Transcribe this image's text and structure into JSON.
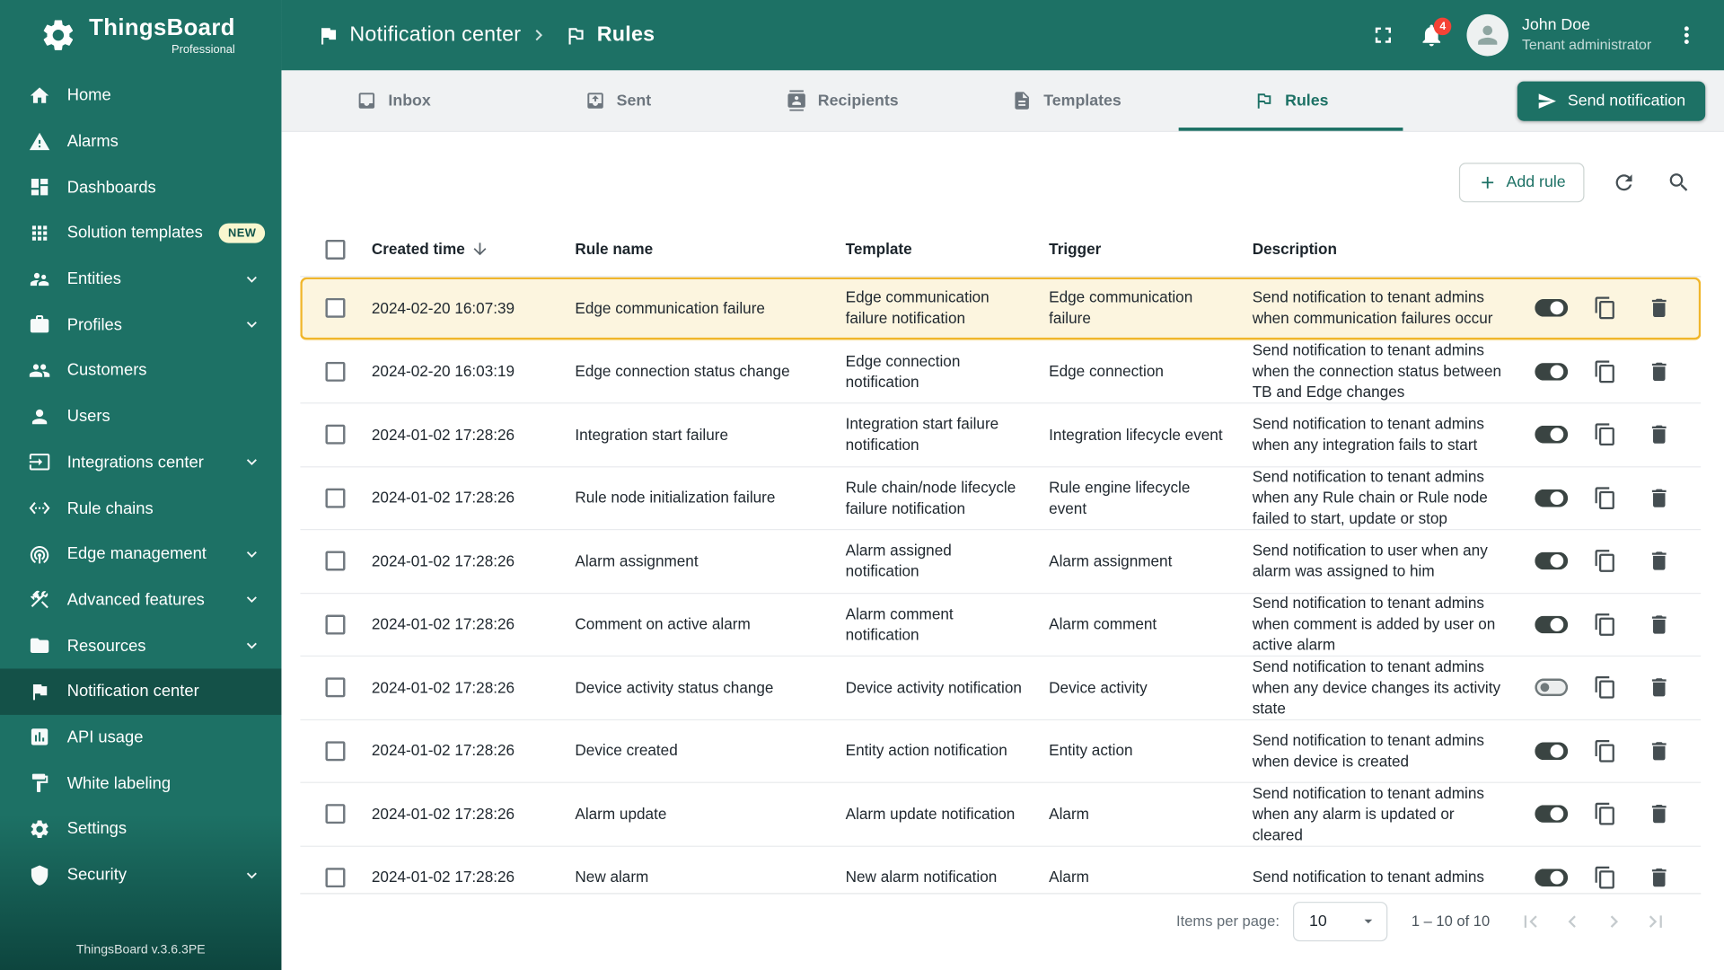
{
  "app": {
    "brand": "ThingsBoard",
    "brand_sub": "Professional",
    "version": "ThingsBoard v.3.6.3PE",
    "logo_icon": "thingsboard-logo-icon"
  },
  "header": {
    "breadcrumb": [
      {
        "icon": "notification-center-icon",
        "label": "Notification center"
      },
      {
        "icon": "rules-icon",
        "label": "Rules"
      }
    ],
    "separator_icon": "chevron-right-icon",
    "fullscreen_icon": "fullscreen-icon",
    "bell_icon": "bell-icon",
    "notifications_count": "4",
    "avatar_icon": "person-icon",
    "menu_icon": "kebab-icon",
    "user": {
      "name": "John Doe",
      "role": "Tenant administrator"
    }
  },
  "sidebar": {
    "expand_icon": "chevron-down-icon",
    "items": [
      {
        "name": "sidebar-item-home",
        "label": "Home",
        "icon": "home-icon"
      },
      {
        "name": "sidebar-item-alarms",
        "label": "Alarms",
        "icon": "alarms-icon"
      },
      {
        "name": "sidebar-item-dashboards",
        "label": "Dashboards",
        "icon": "dashboards-icon"
      },
      {
        "name": "sidebar-item-solution-templates",
        "label": "Solution templates",
        "icon": "solution-templates-icon",
        "badge": "NEW"
      },
      {
        "name": "sidebar-item-entities",
        "label": "Entities",
        "icon": "entities-icon",
        "expandable": true
      },
      {
        "name": "sidebar-item-profiles",
        "label": "Profiles",
        "icon": "profiles-icon",
        "expandable": true
      },
      {
        "name": "sidebar-item-customers",
        "label": "Customers",
        "icon": "customers-icon"
      },
      {
        "name": "sidebar-item-users",
        "label": "Users",
        "icon": "users-icon"
      },
      {
        "name": "sidebar-item-integrations-center",
        "label": "Integrations center",
        "icon": "integrations-icon",
        "expandable": true
      },
      {
        "name": "sidebar-item-rule-chains",
        "label": "Rule chains",
        "icon": "rule-chains-icon"
      },
      {
        "name": "sidebar-item-edge-management",
        "label": "Edge management",
        "icon": "edge-icon",
        "expandable": true
      },
      {
        "name": "sidebar-item-advanced-features",
        "label": "Advanced features",
        "icon": "advanced-features-icon",
        "expandable": true
      },
      {
        "name": "sidebar-item-resources",
        "label": "Resources",
        "icon": "resources-icon",
        "expandable": true
      },
      {
        "name": "sidebar-item-notification-center",
        "label": "Notification center",
        "icon": "notification-center-icon",
        "active": true
      },
      {
        "name": "sidebar-item-api-usage",
        "label": "API usage",
        "icon": "api-usage-icon"
      },
      {
        "name": "sidebar-item-white-labeling",
        "label": "White labeling",
        "icon": "white-labeling-icon"
      },
      {
        "name": "sidebar-item-settings",
        "label": "Settings",
        "icon": "settings-icon"
      },
      {
        "name": "sidebar-item-security",
        "label": "Security",
        "icon": "security-icon",
        "expandable": true
      }
    ]
  },
  "tabs": [
    {
      "name": "tab-inbox",
      "label": "Inbox",
      "icon": "inbox-icon"
    },
    {
      "name": "tab-sent",
      "label": "Sent",
      "icon": "sent-icon"
    },
    {
      "name": "tab-recipients",
      "label": "Recipients",
      "icon": "recipients-icon"
    },
    {
      "name": "tab-templates",
      "label": "Templates",
      "icon": "templates-icon"
    },
    {
      "name": "tab-rules",
      "label": "Rules",
      "icon": "rules-icon",
      "active": true
    }
  ],
  "actions": {
    "send_notification": "Send notification",
    "send_icon": "send-icon",
    "add_rule": "Add rule",
    "add_icon": "plus-icon",
    "refresh_icon": "refresh-icon",
    "search_icon": "search-icon"
  },
  "table": {
    "columns": [
      "Created time",
      "Rule name",
      "Template",
      "Trigger",
      "Description"
    ],
    "sort_icon": "arrow-down-icon",
    "copy_icon": "copy-icon",
    "delete_icon": "delete-icon",
    "rows": [
      {
        "time": "2024-02-20 16:07:39",
        "rule": "Edge communication failure",
        "template": "Edge communication failure notification",
        "trigger": "Edge communication failure",
        "description": "Send notification to tenant admins when communication failures occur",
        "enabled": true,
        "highlighted": true
      },
      {
        "time": "2024-02-20 16:03:19",
        "rule": "Edge connection status change",
        "template": "Edge connection notification",
        "trigger": "Edge connection",
        "description": "Send notification to tenant admins when the connection status between TB and Edge changes",
        "enabled": true
      },
      {
        "time": "2024-01-02 17:28:26",
        "rule": "Integration start failure",
        "template": "Integration start failure notification",
        "trigger": "Integration lifecycle event",
        "description": "Send notification to tenant admins when any integration fails to start",
        "enabled": true
      },
      {
        "time": "2024-01-02 17:28:26",
        "rule": "Rule node initialization failure",
        "template": "Rule chain/node lifecycle failure notification",
        "trigger": "Rule engine lifecycle event",
        "description": "Send notification to tenant admins when any Rule chain or Rule node failed to start, update or stop",
        "enabled": true
      },
      {
        "time": "2024-01-02 17:28:26",
        "rule": "Alarm assignment",
        "template": "Alarm assigned notification",
        "trigger": "Alarm assignment",
        "description": "Send notification to user when any alarm was assigned to him",
        "enabled": true
      },
      {
        "time": "2024-01-02 17:28:26",
        "rule": "Comment on active alarm",
        "template": "Alarm comment notification",
        "trigger": "Alarm comment",
        "description": "Send notification to tenant admins when comment is added by user on active alarm",
        "enabled": true
      },
      {
        "time": "2024-01-02 17:28:26",
        "rule": "Device activity status change",
        "template": "Device activity notification",
        "trigger": "Device activity",
        "description": "Send notification to tenant admins when any device changes its activity state",
        "enabled": false
      },
      {
        "time": "2024-01-02 17:28:26",
        "rule": "Device created",
        "template": "Entity action notification",
        "trigger": "Entity action",
        "description": "Send notification to tenant admins when device is created",
        "enabled": true
      },
      {
        "time": "2024-01-02 17:28:26",
        "rule": "Alarm update",
        "template": "Alarm update notification",
        "trigger": "Alarm",
        "description": "Send notification to tenant admins when any alarm is updated or cleared",
        "enabled": true
      },
      {
        "time": "2024-01-02 17:28:26",
        "rule": "New alarm",
        "template": "New alarm notification",
        "trigger": "Alarm",
        "description": "Send notification to tenant admins",
        "enabled": true
      }
    ]
  },
  "pagination": {
    "items_per_page_label": "Items per page:",
    "items_per_page": "10",
    "range": "1 – 10 of 10",
    "dropdown_icon": "dropdown-icon",
    "first_icon": "first-page-icon",
    "prev_icon": "prev-page-icon",
    "next_icon": "next-page-icon",
    "last_icon": "last-page-icon"
  },
  "colors": {
    "accent": "#1d7165",
    "header-bg": "#1d7165",
    "sidebar-bg": "#1d7165",
    "tabbar-bg": "#f0f2f3",
    "highlight-border": "#f0b62b",
    "highlight-bg": "#fcf5df",
    "badge-bg": "#f44336",
    "newbadge-bg": "#f9f7cf",
    "toggle-on": "#3a4442"
  }
}
